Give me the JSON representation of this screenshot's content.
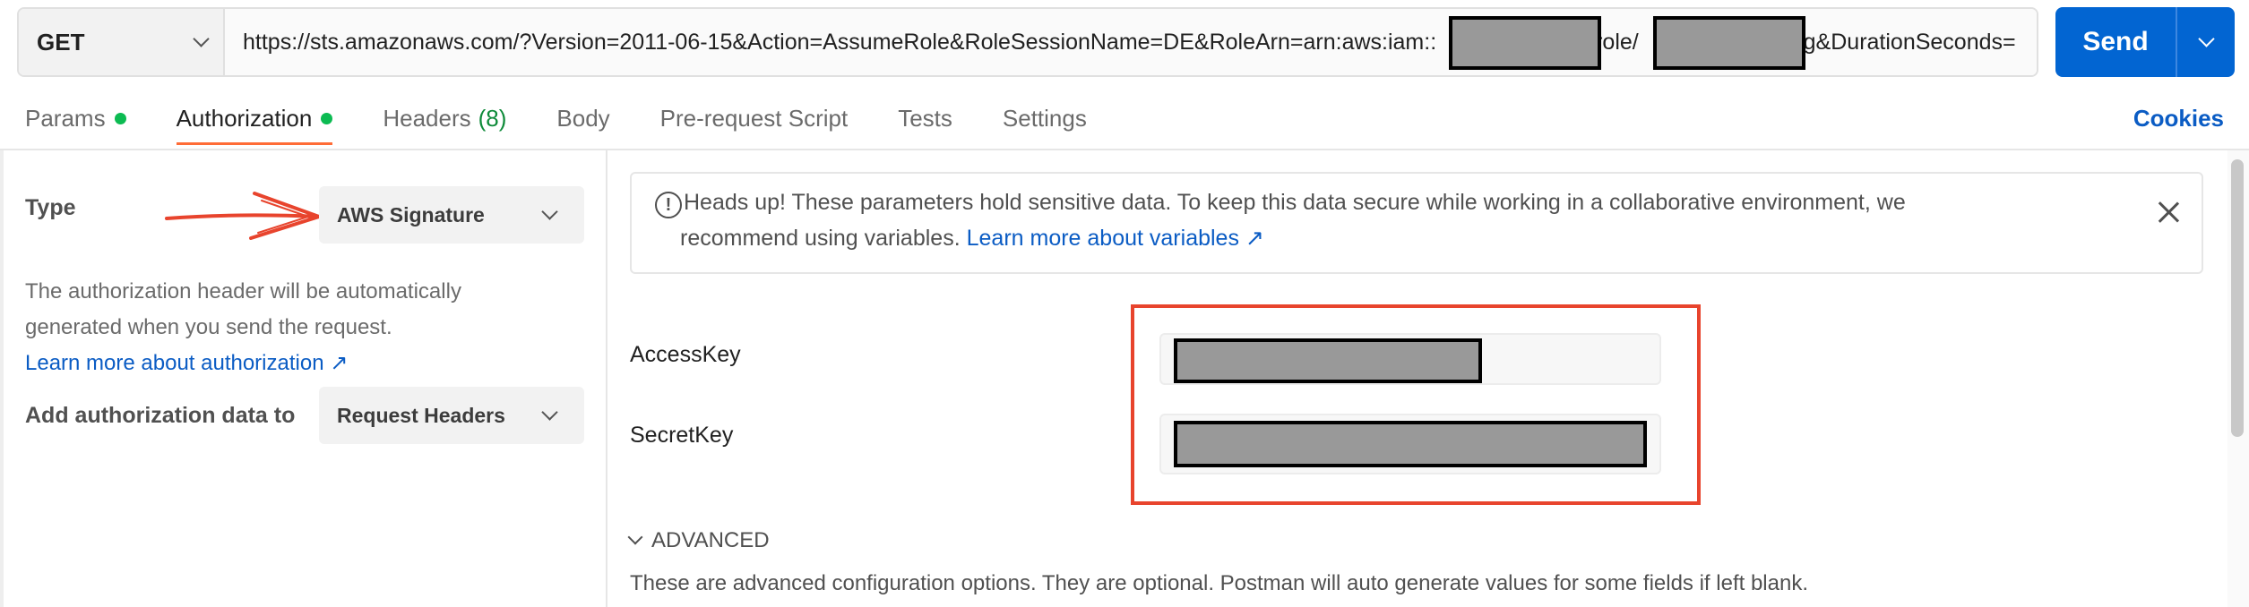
{
  "request": {
    "method": "GET",
    "url_part1": "https://sts.amazonaws.com/?Version=2011-06-15&Action=AssumeRole&RoleSessionName=DE&RoleArn=arn:aws:iam::",
    "url_part2": ":role/",
    "url_part3": "ng&DurationSeconds=",
    "send_label": "Send"
  },
  "tabs": [
    {
      "label": "Params",
      "dot": true
    },
    {
      "label": "Authorization",
      "dot": true,
      "active": true
    },
    {
      "label": "Headers",
      "count": "(8)"
    },
    {
      "label": "Body"
    },
    {
      "label": "Pre-request Script"
    },
    {
      "label": "Tests"
    },
    {
      "label": "Settings"
    }
  ],
  "cookies_label": "Cookies",
  "auth": {
    "type_label": "Type",
    "type_value": "AWS Signature",
    "help_text": "The authorization header will be automatically generated when you send the request.",
    "help_link": "Learn more about authorization ↗",
    "add_to_label": "Add authorization data to",
    "add_to_value": "Request Headers"
  },
  "alert": {
    "text": "Heads up! These parameters hold sensitive data. To keep this data secure while working in a collaborative environment, we recommend using variables.",
    "link": "Learn more about variables ↗"
  },
  "fields": {
    "access_key_label": "AccessKey",
    "secret_key_label": "SecretKey"
  },
  "advanced": {
    "label": "ADVANCED",
    "description": "These are advanced configuration options. They are optional. Postman will auto generate values for some fields if left blank."
  },
  "colors": {
    "send_button": "#0265d2",
    "active_tab_underline": "#ff6c37",
    "status_dot": "#0cbb52",
    "link": "#0b5cc4",
    "annotation": "#e8442d",
    "redaction": "#999999"
  }
}
